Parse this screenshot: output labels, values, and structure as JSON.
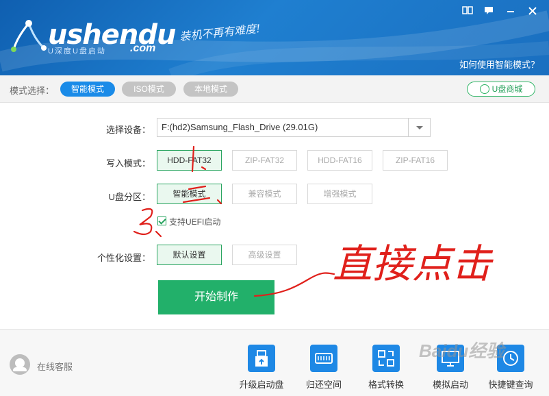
{
  "header": {
    "logo_text": "ushendu",
    "logo_com": ".com",
    "logo_sub": "U深度U盘启动",
    "slogan": "装机不再有难度!",
    "help_link": "如何使用智能模式？",
    "window_buttons": [
      "book-icon",
      "message-icon",
      "minimize-icon",
      "close-icon"
    ]
  },
  "mode_bar": {
    "label": "模式选择：",
    "tabs": [
      {
        "label": "智能模式",
        "active": true
      },
      {
        "label": "ISO模式",
        "active": false
      },
      {
        "label": "本地模式",
        "active": false
      }
    ],
    "shop_button": "U盘商城"
  },
  "form": {
    "device": {
      "label": "选择设备：",
      "value": "F:(hd2)Samsung_Flash_Drive (29.01G)"
    },
    "write_mode": {
      "label": "写入模式：",
      "options": [
        {
          "label": "HDD-FAT32",
          "active": true
        },
        {
          "label": "ZIP-FAT32",
          "active": false
        },
        {
          "label": "HDD-FAT16",
          "active": false
        },
        {
          "label": "ZIP-FAT16",
          "active": false
        }
      ]
    },
    "partition": {
      "label": "U盘分区：",
      "options": [
        {
          "label": "智能模式",
          "active": true
        },
        {
          "label": "兼容模式",
          "active": false
        },
        {
          "label": "增强模式",
          "active": false
        }
      ]
    },
    "uefi": {
      "label": "支持UEFI启动",
      "checked": true
    },
    "personalize": {
      "label": "个性化设置：",
      "options": [
        {
          "label": "默认设置",
          "active": true
        },
        {
          "label": "高级设置",
          "active": false
        }
      ]
    },
    "start_button": "开始制作"
  },
  "annotations": {
    "num1": "1、",
    "num2": "2、",
    "num3": "3、",
    "note": "直接点击"
  },
  "footer": {
    "support": "在线客服",
    "tools": [
      {
        "label": "升级启动盘",
        "icon": "upgrade-usb-icon"
      },
      {
        "label": "归还空间",
        "icon": "restore-space-icon"
      },
      {
        "label": "格式转换",
        "icon": "format-convert-icon"
      },
      {
        "label": "模拟启动",
        "icon": "simulate-boot-icon"
      },
      {
        "label": "快捷键查询",
        "icon": "hotkey-query-icon"
      }
    ],
    "watermark": "Baidu经验"
  },
  "colors": {
    "header_blue": "#1a6fc0",
    "active_tab": "#1a8be8",
    "green": "#22b06a",
    "handwriting_red": "#e0201b"
  }
}
